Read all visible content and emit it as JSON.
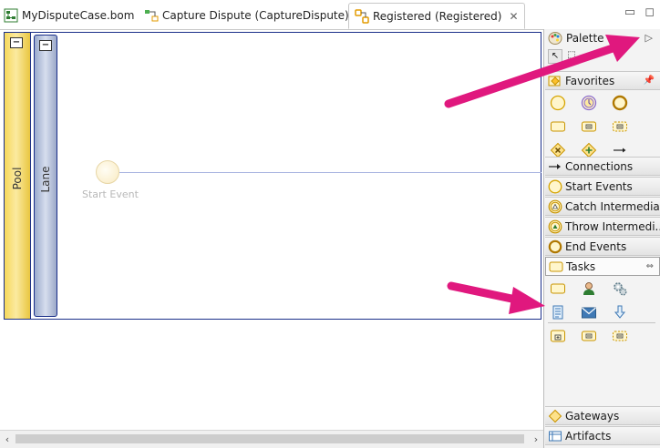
{
  "tabs": [
    {
      "label": "MyDisputeCase.bom",
      "icon": "bom-model-icon"
    },
    {
      "label": "Capture Dispute (CaptureDispute)",
      "icon": "process-icon"
    },
    {
      "label": "Registered (Registered)",
      "icon": "process-icon",
      "active": true
    }
  ],
  "diagram": {
    "pool_label": "Pool",
    "lane_label": "Lane",
    "start_event_label": "Start Event",
    "collapse_symbol": "−"
  },
  "palette": {
    "title": "Palette",
    "drawers": {
      "favorites": "Favorites",
      "connections": "Connections",
      "start_events": "Start Events",
      "catch_intermediate": "Catch Intermedia...",
      "throw_intermediate": "Throw Intermedi...",
      "end_events": "End Events",
      "tasks": "Tasks",
      "gateways": "Gateways",
      "artifacts": "Artifacts"
    }
  },
  "colors": {
    "annotation_arrow": "#e0187e",
    "pool_fill": "#f6d85a",
    "lane_fill": "#c2cce2",
    "border": "#1a2f8a"
  }
}
